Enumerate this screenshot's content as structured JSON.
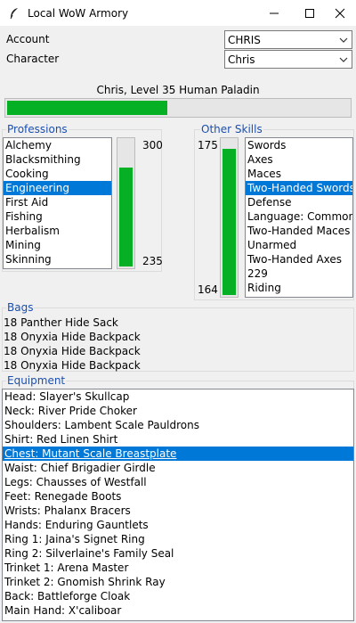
{
  "window": {
    "title": "Local WoW Armory",
    "icon": "feather-icon"
  },
  "controls": {
    "account_label": "Account",
    "account_value": "CHRIS",
    "character_label": "Character",
    "character_value": "Chris"
  },
  "character": {
    "summary": "Chris, Level 35 Human Paladin",
    "xp_progress": 0.47
  },
  "professions": {
    "title": "Professions",
    "items": [
      "Alchemy",
      "Blacksmithing",
      "Cooking",
      "Engineering",
      "First Aid",
      "Fishing",
      "Herbalism",
      "Mining",
      "Skinning"
    ],
    "selected_index": 3,
    "skill_max": "300",
    "skill_current": "235",
    "skill_fraction": 0.78
  },
  "other_skills": {
    "title": "Other Skills",
    "items": [
      "Swords",
      "Axes",
      "Maces",
      "Two-Handed Swords",
      "Defense",
      "Language: Common",
      "Two-Handed Maces",
      "Unarmed",
      "Two-Handed Axes",
      "229",
      "Riding"
    ],
    "selected_index": 3,
    "skill_max": "175",
    "skill_current": "164",
    "skill_fraction": 0.94
  },
  "bags": {
    "title": "Bags",
    "items": [
      "18 Panther Hide Sack",
      "18 Onyxia Hide Backpack",
      "18 Onyxia Hide Backpack",
      "18 Onyxia Hide Backpack"
    ]
  },
  "equipment": {
    "title": "Equipment",
    "items": [
      "Head: Slayer's Skullcap",
      "Neck: River Pride Choker",
      "Shoulders: Lambent Scale Pauldrons",
      "Shirt: Red Linen Shirt",
      "Chest: Mutant Scale Breastplate",
      "Waist: Chief Brigadier Girdle",
      "Legs: Chausses of Westfall",
      "Feet: Renegade Boots",
      "Wrists: Phalanx Bracers",
      "Hands: Enduring Gauntlets",
      "Ring 1: Jaina's Signet Ring",
      "Ring 2: Silverlaine's Family Seal",
      "Trinket 1: Arena Master",
      "Trinket 2: Gnomish Shrink Ray",
      "Back: Battleforge Cloak",
      "Main Hand: X'caliboar"
    ],
    "selected_index": 4
  },
  "colors": {
    "accent": "#0078d7",
    "progress": "#06b025",
    "group_title": "#1a4fb0"
  }
}
